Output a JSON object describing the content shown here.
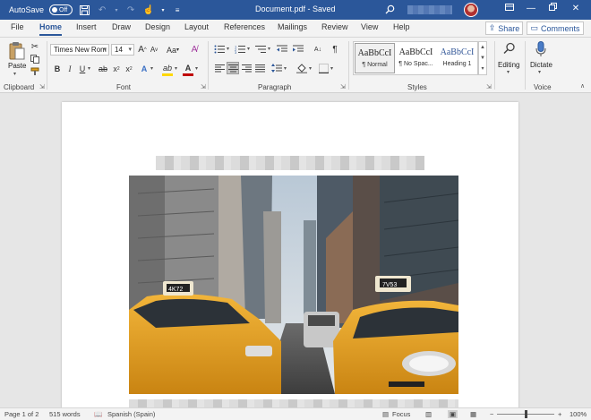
{
  "titlebar": {
    "autosave_label": "AutoSave",
    "autosave_state": "Off",
    "document_title": "Document.pdf - Saved",
    "icons": [
      "save-icon",
      "undo-icon",
      "redo-icon",
      "touch-mode-icon",
      "customize-icon",
      "search-icon"
    ],
    "window_controls": [
      "minimize",
      "restore",
      "close"
    ]
  },
  "tabs": [
    "File",
    "Home",
    "Insert",
    "Draw",
    "Design",
    "Layout",
    "References",
    "Mailings",
    "Review",
    "View",
    "Help"
  ],
  "active_tab": "Home",
  "actions": {
    "share": "Share",
    "comments": "Comments"
  },
  "ribbon": {
    "clipboard": {
      "label": "Clipboard",
      "paste": "Paste"
    },
    "font": {
      "label": "Font",
      "font_name": "Times New Rom",
      "font_size": "14",
      "grow": "A",
      "shrink": "A",
      "case": "Aa",
      "bold": "B",
      "italic": "I",
      "underline": "U",
      "strike": "ab",
      "subscript": "x",
      "superscript": "x",
      "effects": "A",
      "highlight": "ab",
      "font_color": "A"
    },
    "paragraph": {
      "label": "Paragraph"
    },
    "styles": {
      "label": "Styles",
      "items": [
        {
          "sample": "AaBbCcI",
          "name": "¶ Normal"
        },
        {
          "sample": "AaBbCcI",
          "name": "¶ No Spac..."
        },
        {
          "sample": "AaBbCcI",
          "name": "Heading 1"
        }
      ]
    },
    "editing": {
      "label": "Editing"
    },
    "voice": {
      "label": "Voice",
      "dictate": "Dictate"
    }
  },
  "statusbar": {
    "page": "Page 1 of 2",
    "words": "515 words",
    "language": "Spanish (Spain)",
    "focus": "Focus",
    "zoom": "100%",
    "zoom_minus": "−",
    "zoom_plus": "+"
  },
  "colors": {
    "titlebar": "#2b579a",
    "highlight": "#ffd800",
    "font_color": "#c00000"
  }
}
